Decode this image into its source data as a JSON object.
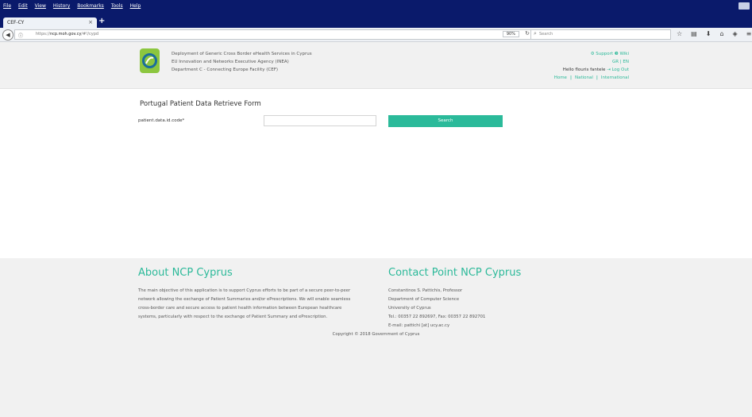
{
  "browser": {
    "menu": [
      "File",
      "Edit",
      "View",
      "History",
      "Bookmarks",
      "Tools",
      "Help"
    ],
    "tab_title": "CEF-CY",
    "tab_close": "×",
    "new_tab": "+",
    "url_host": "ncp.moh.gov.cy",
    "url_path": "/#!/cypd",
    "url_prefix": "https://",
    "zoom": "90%",
    "search_placeholder": "Search",
    "icons": [
      "info-icon",
      "lock-icon",
      "back-icon",
      "reload-icon",
      "bookmark-star-icon",
      "reading-list-icon",
      "download-icon",
      "home-icon",
      "pocket-icon",
      "menu-icon"
    ]
  },
  "header": {
    "org_lines": [
      "Deployment of Generic Cross Border eHealth Services in Cyprus",
      "EU Innovation and Networks Executive Agency (INEA)",
      "Department C - Connecting Europe Facility (CEF)"
    ],
    "support": "Support",
    "wiki": "Wiki",
    "lang": "GR | EN",
    "hello": "Hello flouris fantele",
    "logout": "Log Out",
    "nav": [
      "Home",
      "National",
      "International"
    ]
  },
  "form": {
    "title": "Portugal Patient Data Retrieve Form",
    "field_label": "patient.data.id.code*",
    "field_value": "",
    "search_button": "Search"
  },
  "footer": {
    "about_title": "About NCP Cyprus",
    "about_lines": [
      "The main objective of this application is to support Cyprus efforts to be part of a secure peer-to-peer",
      "network allowing the exchange of Patient Summaries and/or ePrescriptions. We will enable seamless",
      "cross-border care and secure access to patient health information between European healthcare",
      "systems, particularly with respect to the exchange of Patient Summary and ePrescription."
    ],
    "contact_title": "Contact Point NCP Cyprus",
    "contact_lines": [
      "Constantinos S. Pattichis, Professor",
      "Department of Computer Science",
      "University of Cyprus",
      "Tel.: 00357 22 892697, Fax: 00357 22 892701",
      "E-mail: pattichi [at] ucy.ac.cy"
    ],
    "copyright": "Copyright © 2018 Government of Cyprus"
  },
  "colors": {
    "accent": "#2bba9a",
    "browser_bar": "#0a1a6b",
    "logo_green": "#8cc63f"
  }
}
